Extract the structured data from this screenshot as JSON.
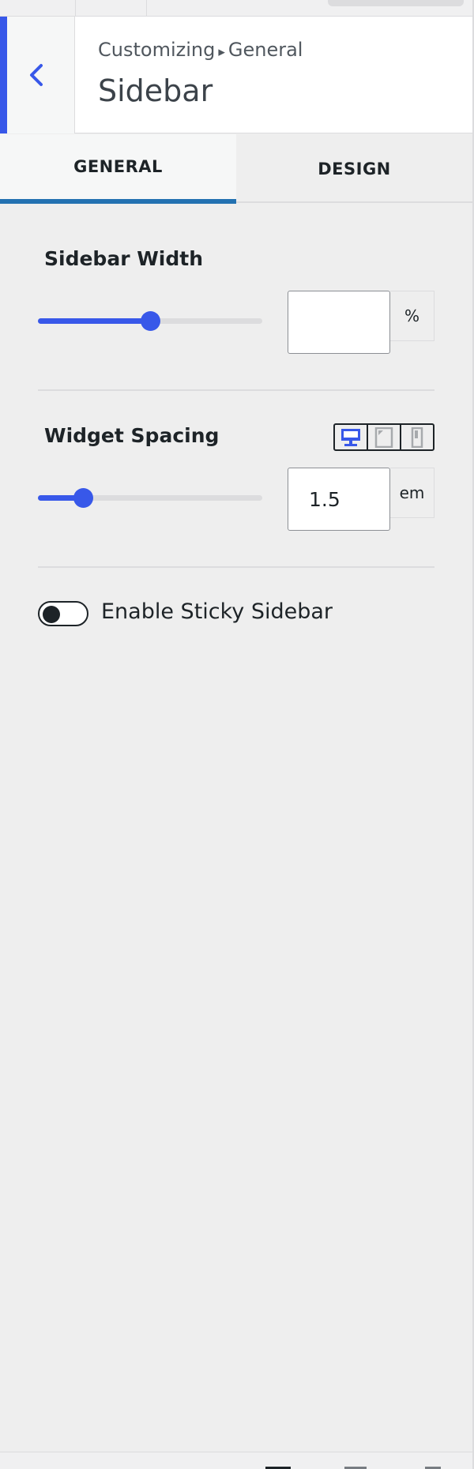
{
  "header": {
    "breadcrumb_part1": "Customizing",
    "breadcrumb_arrow": "▸",
    "breadcrumb_part2": "General",
    "title": "Sidebar"
  },
  "tabs": [
    {
      "label": "GENERAL",
      "active": true
    },
    {
      "label": "DESIGN",
      "active": false
    }
  ],
  "sidebar_width": {
    "label": "Sidebar Width",
    "value": "",
    "unit": "%",
    "slider_fraction": 0.5
  },
  "widget_spacing": {
    "label": "Widget Spacing",
    "value": "1.5",
    "unit": "em",
    "slider_fraction": 0.2,
    "devices": [
      {
        "icon": "desktop-icon",
        "active": true
      },
      {
        "icon": "tablet-icon",
        "active": false
      },
      {
        "icon": "mobile-icon",
        "active": false
      }
    ]
  },
  "sticky": {
    "label": "Enable Sticky Sidebar",
    "enabled": false
  },
  "colors": {
    "accent": "#3858e9",
    "tab_underline": "#2271b1"
  }
}
